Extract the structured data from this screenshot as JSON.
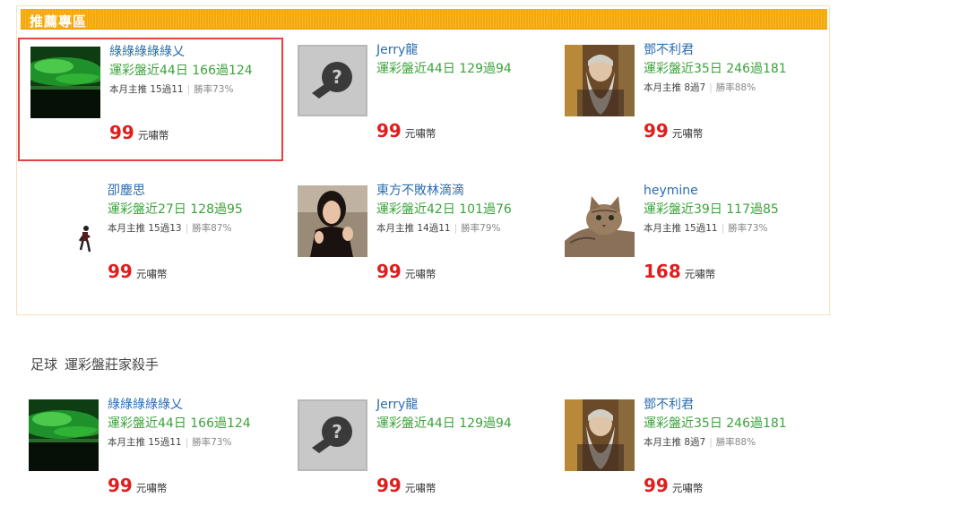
{
  "recommended": {
    "title": "推薦專區",
    "cards": [
      {
        "name": "綠綠綠綠綠乂",
        "stat": "運彩盤近44日 166過124",
        "monthly": "本月主推 15過11",
        "rate": "勝率73%",
        "price": "99",
        "unit": "元嘯幣"
      },
      {
        "name": "Jerry龍",
        "stat": "運彩盤近44日 129過94",
        "monthly": "",
        "rate": "",
        "price": "99",
        "unit": "元嘯幣"
      },
      {
        "name": "鄧不利君",
        "stat": "運彩盤近35日 246過181",
        "monthly": "本月主推 8過7",
        "rate": "勝率88%",
        "price": "99",
        "unit": "元嘯幣"
      },
      {
        "name": "卲塵思",
        "stat": "運彩盤近27日 128過95",
        "monthly": "本月主推 15過13",
        "rate": "勝率87%",
        "price": "99",
        "unit": "元嘯幣"
      },
      {
        "name": "東方不敗林滴滴",
        "stat": "運彩盤近42日 101過76",
        "monthly": "本月主推 14過11",
        "rate": "勝率79%",
        "price": "99",
        "unit": "元嘯幣"
      },
      {
        "name": "heymine",
        "stat": "運彩盤近39日 117過85",
        "monthly": "本月主推 15過11",
        "rate": "勝率73%",
        "price": "168",
        "unit": "元嘯幣"
      }
    ]
  },
  "section": {
    "sport": "足球",
    "title": "運彩盤莊家殺手",
    "cards": [
      {
        "name": "綠綠綠綠綠乂",
        "stat": "運彩盤近44日 166過124",
        "monthly": "本月主推 15過11",
        "rate": "勝率73%",
        "price": "99",
        "unit": "元嘯幣"
      },
      {
        "name": "Jerry龍",
        "stat": "運彩盤近44日 129過94",
        "monthly": "",
        "rate": "",
        "price": "99",
        "unit": "元嘯幣"
      },
      {
        "name": "鄧不利君",
        "stat": "運彩盤近35日 246過181",
        "monthly": "本月主推 8過7",
        "rate": "勝率88%",
        "price": "99",
        "unit": "元嘯幣"
      }
    ]
  }
}
